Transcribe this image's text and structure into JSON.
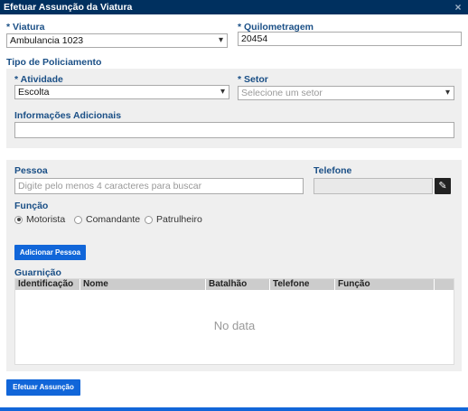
{
  "dialog": {
    "title": "Efetuar Assunção da Viatura",
    "close_glyph": "×"
  },
  "viatura": {
    "label": "* Viatura",
    "value": "Ambulancia 1023"
  },
  "quilometragem": {
    "label": "* Quilometragem",
    "value": "20454"
  },
  "tipo_policiamento": {
    "label": "Tipo de Policiamento",
    "atividade": {
      "label": "* Atividade",
      "value": "Escolta"
    },
    "setor": {
      "label": "* Setor",
      "placeholder": "Selecione um setor"
    },
    "info_adicionais": {
      "label": "Informações Adicionais",
      "value": ""
    }
  },
  "pessoa": {
    "label": "Pessoa",
    "placeholder": "Digite pelo menos 4 caracteres para buscar",
    "telefone_label": "Telefone",
    "telefone_value": "",
    "edit_icon": "pencil-icon"
  },
  "funcao": {
    "label": "Função",
    "options": [
      {
        "label": "Motorista",
        "selected": true
      },
      {
        "label": "Comandante",
        "selected": false
      },
      {
        "label": "Patrulheiro",
        "selected": false
      }
    ]
  },
  "adicionar_pessoa_label": "Adicionar Pessoa",
  "guarnicao": {
    "label": "Guarnição",
    "columns": [
      "Identificação",
      "Nome",
      "Batalhão",
      "Telefone",
      "Função"
    ],
    "empty_text": "No data"
  },
  "submit_label": "Efetuar Assunção",
  "colors": {
    "title_bg": "#00305f",
    "label": "#1a4f86",
    "button": "#1166d9",
    "panel": "#efefef"
  }
}
